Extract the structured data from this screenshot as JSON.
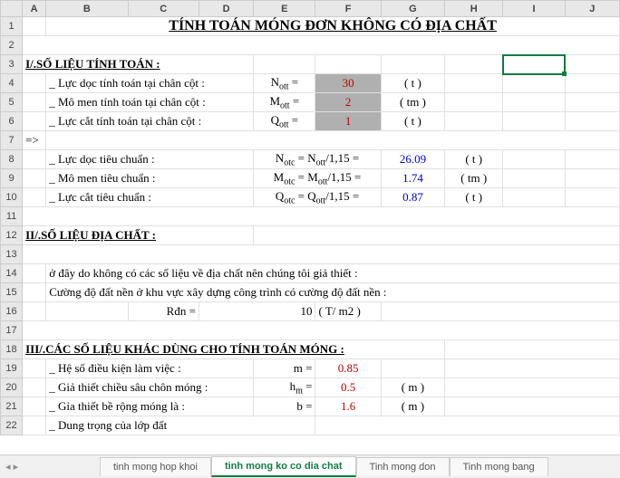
{
  "cols": [
    "A",
    "B",
    "C",
    "D",
    "E",
    "F",
    "G",
    "H",
    "I",
    "J"
  ],
  "rows": [
    "1",
    "2",
    "3",
    "4",
    "5",
    "6",
    "7",
    "8",
    "9",
    "10",
    "11",
    "12",
    "13",
    "14",
    "15",
    "16",
    "17",
    "18",
    "19",
    "20",
    "21",
    "22"
  ],
  "title": "TÍNH TOÁN MÓNG ĐƠN KHÔNG CÓ ĐỊA CHẤT",
  "sec1": "I/.SỐ LIỆU TÍNH TOÁN :",
  "r4": {
    "label": "_ Lực dọc tính toán tại chân cột :",
    "sym": "Nott  =",
    "val": "30",
    "unit": "( t )"
  },
  "r5": {
    "label": "_ Mô men tính toán tại chân cột :",
    "sym": "Mott  =",
    "val": "2",
    "unit": "( tm )"
  },
  "r6": {
    "label": "_ Lực cắt tính toán tại chân cột :",
    "sym": "Qott  =",
    "val": "1",
    "unit": "( t )"
  },
  "r7": {
    "arrow": "=>"
  },
  "r8": {
    "label": "_ Lực dọc tiêu chuẩn :",
    "sym": "Notc = Nott/1,15  =",
    "val": "26.09",
    "unit": "( t )"
  },
  "r9": {
    "label": "_ Mô men tiêu chuẩn :",
    "sym": "Motc = Mott/1,15  =",
    "val": "1.74",
    "unit": "( tm )"
  },
  "r10": {
    "label": "_ Lực cắt tiêu chuẩn :",
    "sym": "Qotc = Qott/1,15  =",
    "val": "0.87",
    "unit": "( t )"
  },
  "sec2": "II/.SỐ LIỆU ĐỊA CHẤT :",
  "r14": "ở đây do không có các số liệu về địa chất  nên chúng tôi giả thiết :",
  "r15": "Cường độ đất nền ở khu vực xây dựng công trình có cường độ đất nền :",
  "r16": {
    "sym": "Rđn =",
    "val": "10",
    "unit": "( T/ m2 )"
  },
  "sec3": "III/.CÁC SỐ LIỆU KHÁC DÙNG CHO TÍNH TOÁN MÓNG :",
  "r19": {
    "label": "_ Hệ số điều kiện làm việc :",
    "sym": "m  =",
    "val": "0.85",
    "unit": ""
  },
  "r20": {
    "label": "_ Giả thiết chiều sâu chôn móng :",
    "sym": "hm =",
    "val": "0.5",
    "unit": "( m )"
  },
  "r21": {
    "label": "_ Gỉa thiết bề rộng móng là :",
    "sym": "b  =",
    "val": "1.6",
    "unit": "( m )"
  },
  "r22": {
    "label": "_ Dung trọng của lớp đất"
  },
  "tabs": {
    "t1": "tinh mong hop khoi",
    "t2": "tinh mong ko co dia chat",
    "t3": "Tinh mong don",
    "t4": "Tinh mong bang"
  }
}
